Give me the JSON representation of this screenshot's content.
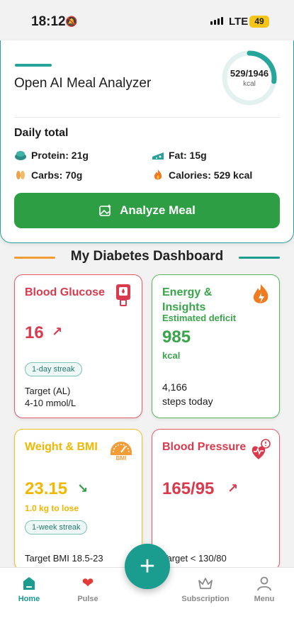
{
  "status": {
    "time": "18:12",
    "network": "LTE",
    "battery": "49"
  },
  "meal_card": {
    "title": "Open AI Meal Analyzer",
    "calories_progress": "529/1946",
    "calories_unit": "kcal",
    "calories_consumed": 529,
    "calories_goal": 1946,
    "daily_total_label": "Daily total",
    "protein": "Protein: 21g",
    "fat": "Fat: 15g",
    "carbs": "Carbs: 70g",
    "calories": "Calories: 529 kcal",
    "analyze_button": "Analyze Meal"
  },
  "dashboard": {
    "title": "My Diabetes Dashboard",
    "glucose": {
      "title": "Blood Glucose",
      "value": "16",
      "streak": "1-day streak",
      "target_line1": "Target (AL)",
      "target_line2": "4-10 mmol/L"
    },
    "energy": {
      "title": "Energy & Insights",
      "subtitle": "Estimated deficit",
      "value": "985",
      "unit": "kcal",
      "steps_value": "4,166",
      "steps_label": "steps today"
    },
    "weight": {
      "title": "Weight & BMI",
      "value": "23.15",
      "subtitle": "1.0 kg to lose",
      "streak": "1-week streak",
      "target": "Target BMI 18.5-23"
    },
    "bp": {
      "title": "Blood Pressure",
      "value": "165/95",
      "target": "Target < 130/80"
    }
  },
  "nav": {
    "home": "Home",
    "pulse": "Pulse",
    "subscription": "Subscription",
    "menu": "Menu",
    "add": "+"
  },
  "colors": {
    "teal": "#1a9c8e",
    "green": "#2e9e45",
    "red": "#d93a4d",
    "yellow": "#f0b800",
    "orange": "#f39c36"
  }
}
